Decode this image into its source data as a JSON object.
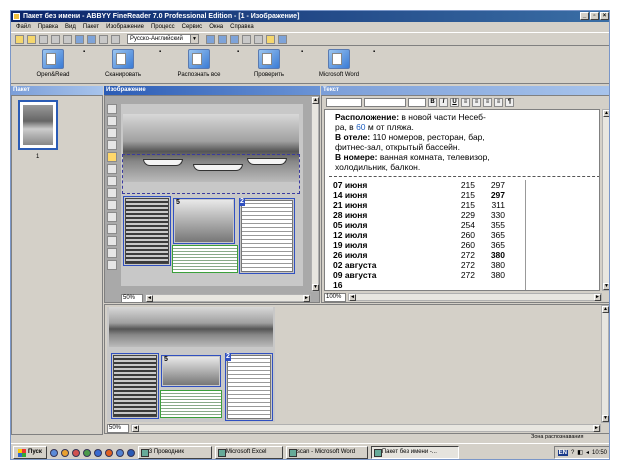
{
  "window": {
    "title": "Пакет без имени - ABBYY FineReader 7.0 Professional Edition - [1 - Изображение]"
  },
  "menu": [
    "Файл",
    "Правка",
    "Вид",
    "Пакет",
    "Изображение",
    "Процесс",
    "Сервис",
    "Окна",
    "Справка"
  ],
  "toolbar": {
    "language": "Русско-Английский"
  },
  "actions": [
    {
      "label": "Open&Read"
    },
    {
      "label": "Сканировать"
    },
    {
      "label": "Распознать все"
    },
    {
      "label": "Проверить"
    },
    {
      "label": "Microsoft Word"
    }
  ],
  "panes": {
    "batch": "Пакет",
    "image": "Изображение",
    "text": "Текст"
  },
  "batch": {
    "page_number": "1"
  },
  "image": {
    "zoom": "50%",
    "zones": [
      "5",
      "2",
      "5",
      "2"
    ]
  },
  "zoom_bottom": "50%",
  "text": {
    "zoom": "100%",
    "location_label": "Расположение:",
    "location_a": " в новой части Несеб-",
    "location_b": "ра, в ",
    "location_num": "60",
    "location_c": " м от пляжа.",
    "hotel_label": "В отеле:",
    "hotel_a": " 110 номеров, ресторан, бар,",
    "hotel_b": "фитнес-зал, открытый бассейн.",
    "room_label": "В номере:",
    "room_a": " ванная комната, телевизор,",
    "room_b": "холодильник, балкон.",
    "rows": [
      {
        "date": "07 июня",
        "v1": "215",
        "v2": "297",
        "bold": false
      },
      {
        "date": "14 июня",
        "v1": "215",
        "v2": "297",
        "bold": true
      },
      {
        "date": "21 июня",
        "v1": "215",
        "v2": "311",
        "bold": false
      },
      {
        "date": "28 июня",
        "v1": "229",
        "v2": "330",
        "bold": false
      },
      {
        "date": "05 июля",
        "v1": "254",
        "v2": "355",
        "bold": false
      },
      {
        "date": "12 июля",
        "v1": "260",
        "v2": "365",
        "bold": false
      },
      {
        "date": "19 июля",
        "v1": "260",
        "v2": "365",
        "bold": false
      },
      {
        "date": "26 июля",
        "v1": "272",
        "v2": "380",
        "bold": true
      },
      {
        "date": "02 августа",
        "v1": "272",
        "v2": "380",
        "bold": false
      },
      {
        "date": "09 августа",
        "v1": "272",
        "v2": "380",
        "bold": false
      },
      {
        "date": "16",
        "v1": "",
        "v2": "",
        "bold": false
      }
    ]
  },
  "status": "Зона распознавания",
  "taskbar": {
    "start": "Пуск",
    "tasks": [
      "3 Проводник",
      "Microsoft Excel",
      "scan - Microsoft Word",
      "Пакет без имени -..."
    ],
    "tray_lang": "EN",
    "time": "10:50"
  }
}
